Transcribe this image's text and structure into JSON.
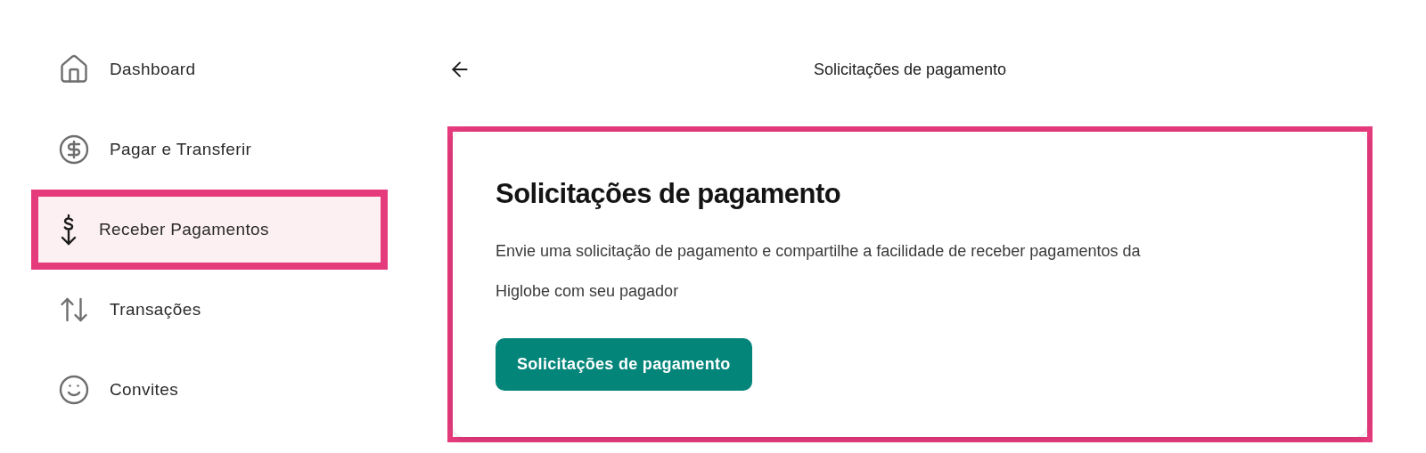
{
  "sidebar": {
    "items": [
      {
        "kind": "home",
        "label": "Dashboard",
        "selected": false,
        "highlighted": false
      },
      {
        "kind": "pay",
        "label": "Pagar e Transferir",
        "selected": false,
        "highlighted": false
      },
      {
        "kind": "receive",
        "label": "Receber Pagamentos",
        "selected": true,
        "highlighted": true
      },
      {
        "kind": "transactions",
        "label": "Transações",
        "selected": false,
        "highlighted": false
      },
      {
        "kind": "invites",
        "label": "Convites",
        "selected": false,
        "highlighted": false
      }
    ]
  },
  "header": {
    "title": "Solicitações de pagamento"
  },
  "card": {
    "highlighted": true,
    "title": "Solicitações de pagamento",
    "text": "Envie uma solicitação de pagamento e compartilhe a facilidade de receber pagamentos da Higlobe com seu pagador",
    "button": "Solicitações de pagamento"
  }
}
